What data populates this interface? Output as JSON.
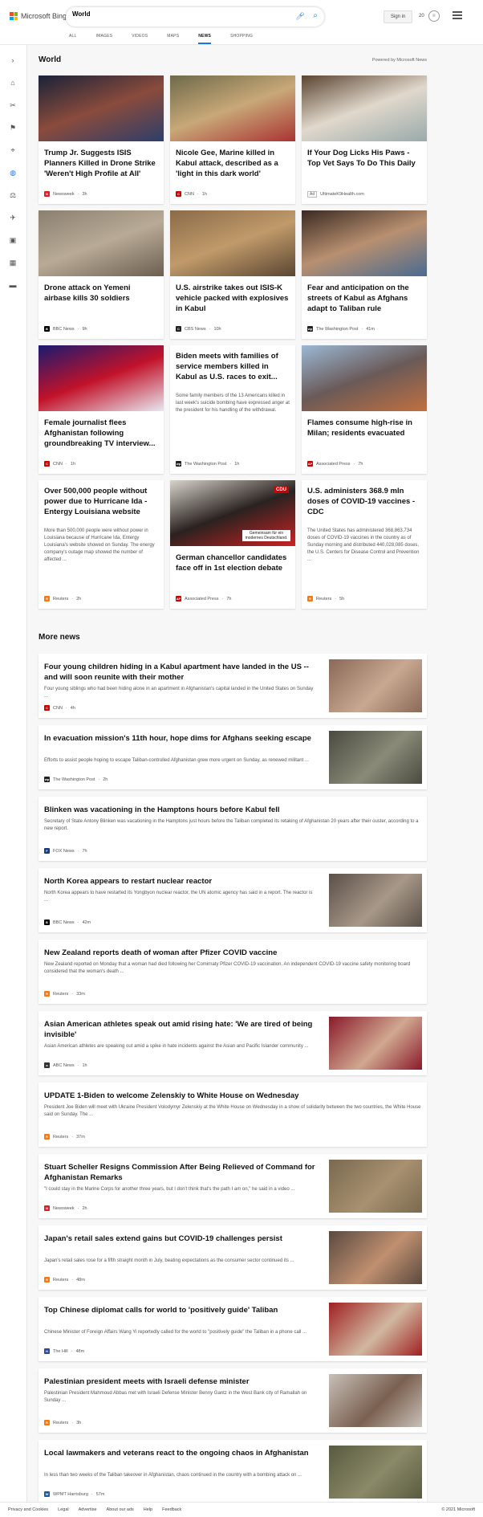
{
  "header": {
    "brand": "Microsoft Bing",
    "search_value": "World",
    "sign_in": "Sign in",
    "rewards_count": "20",
    "nav_tabs": [
      "ALL",
      "IMAGES",
      "VIDEOS",
      "MAPS",
      "NEWS",
      "SHOPPING"
    ],
    "active_tab": "NEWS"
  },
  "main": {
    "section_title": "World",
    "powered_by": "Powered by Microsoft News",
    "more_news_title": "More news"
  },
  "cards": [
    {
      "title": "Trump Jr. Suggests ISIS Planners Killed in Drone Strike 'Weren't High Profile at All'",
      "snippet": "",
      "source": "Newsweek",
      "time": "3h",
      "src_color": "#d2232a",
      "src_letter": "N",
      "img_colors": [
        "#1a2238",
        "#8a4b3c",
        "#2d3e6a"
      ]
    },
    {
      "title": "Nicole Gee, Marine killed in Kabul attack, described as a 'light in this dark world'",
      "snippet": "",
      "source": "CNN",
      "time": "1h",
      "src_color": "#cc0000",
      "src_letter": "C",
      "img_colors": [
        "#6e6a4a",
        "#c8a878",
        "#a33"
      ]
    },
    {
      "title": "If Your Dog Licks His Paws - Top Vet Says To Do This Daily",
      "snippet": "",
      "source": "UltimateK9Health.com",
      "time": "",
      "ad": "Ad",
      "src_color": "#bbb",
      "src_letter": "",
      "img_colors": [
        "#5a4430",
        "#e0d8cc",
        "#9aa"
      ]
    },
    {
      "title": "Drone attack on Yemeni airbase kills 30 soldiers",
      "snippet": "",
      "source": "BBC News",
      "time": "9h",
      "src_color": "#000",
      "src_letter": "B",
      "img_colors": [
        "#8a8070",
        "#b8aa96",
        "#6d5f50"
      ]
    },
    {
      "title": "U.S. airstrike takes out ISIS-K vehicle packed with explosives in Kabul",
      "snippet": "",
      "source": "CBS News",
      "time": "10h",
      "src_color": "#222",
      "src_letter": "C",
      "img_colors": [
        "#8a6a48",
        "#c09a6a",
        "#5a4632"
      ]
    },
    {
      "title": "Fear and anticipation on the streets of Kabul as Afghans adapt to Taliban rule",
      "snippet": "",
      "source": "The Washington Post",
      "time": "41m",
      "src_color": "#222",
      "src_letter": "wp",
      "img_colors": [
        "#3a2a22",
        "#b89070",
        "#4a6a90"
      ]
    },
    {
      "title": "Female journalist flees Afghanistan following groundbreaking TV interview...",
      "snippet": "",
      "source": "CNN",
      "time": "1h",
      "src_color": "#cc0000",
      "src_letter": "C",
      "img_colors": [
        "#1a1a70",
        "#c2122a",
        "#e8e8f0"
      ]
    },
    {
      "title": "Biden meets with families of service members killed in Kabul as U.S. races to exit...",
      "snippet": "Some family members of the 13 Americans killed in last week's suicide bombing have expressed anger at the president for his handling of the withdrawal.",
      "source": "The Washington Post",
      "time": "1h",
      "src_color": "#222",
      "src_letter": "wp",
      "img_colors": []
    },
    {
      "title": "Flames consume high-rise in Milan; residents evacuated",
      "snippet": "",
      "source": "Associated Press",
      "time": "7h",
      "src_color": "#c00",
      "src_letter": "AP",
      "img_colors": [
        "#9bb8d4",
        "#6a5a58",
        "#c07040"
      ]
    },
    {
      "title": "Over 500,000 people without power due to Hurricane Ida - Entergy Louisiana website",
      "snippet": "More than 500,000 people were without power in Louisiana because of Hurricane Ida, Entergy Louisiana's website showed on Sunday. The energy company's outage map showed the number of affected ...",
      "source": "Reuters",
      "time": "2h",
      "src_color": "#f07a1a",
      "src_letter": "R",
      "img_colors": []
    },
    {
      "title": "German chancellor candidates face off in 1st election debate",
      "snippet": "",
      "source": "Associated Press",
      "time": "7h",
      "src_color": "#c00",
      "src_letter": "AP",
      "img_colors": [
        "#d8d4cc",
        "#2a2220",
        "#c22"
      ],
      "img_text": [
        "CDU",
        "Gemeinsam für ein modernes Deutschland."
      ]
    },
    {
      "title": "U.S. administers 368.9 mln doses of COVID-19 vaccines - CDC",
      "snippet": "The United States has administered 368,863,734 doses of COVID-19 vaccines in the country as of Sunday morning and distributed 440,028,085 doses, the U.S. Centers for Disease Control and Prevention ...",
      "source": "Reuters",
      "time": "5h",
      "src_color": "#f07a1a",
      "src_letter": "R",
      "img_colors": []
    }
  ],
  "more_news": [
    {
      "title": "Four young children hiding in a Kabul apartment have landed in the US -- and will soon reunite with their mother",
      "snippet": "Four young siblings who had been hiding alone in an apartment in Afghanistan's capital landed in the United States on Sunday ...",
      "source": "CNN",
      "time": "4h",
      "src_color": "#cc0000",
      "src_letter": "C",
      "img_colors": [
        "#8a6a58",
        "#c8a890"
      ]
    },
    {
      "title": "In evacuation mission's 11th hour, hope dims for Afghans seeking escape",
      "snippet": "Efforts to assist people hoping to escape Taliban-controlled Afghanistan grew more urgent on Sunday, as renewed militant ...",
      "source": "The Washington Post",
      "time": "2h",
      "src_color": "#222",
      "src_letter": "wp",
      "img_colors": [
        "#4a4a40",
        "#8a8a78"
      ]
    },
    {
      "title": "Blinken was vacationing in the Hamptons hours before Kabul fell",
      "snippet": "Secretary of State Antony Blinken was vacationing in the Hamptons just hours before the Taliban completed its retaking of Afghanistan 20 years after their ouster, according to a new report.",
      "source": "FOX News",
      "time": "7h",
      "src_color": "#1a3a7a",
      "src_letter": "F",
      "img_colors": []
    },
    {
      "title": "North Korea appears to restart nuclear reactor",
      "snippet": "North Korea appears to have restarted its Yongbyon nuclear reactor, the UN atomic agency has said in a report. The reactor is ...",
      "source": "BBC News",
      "time": "42m",
      "src_color": "#000",
      "src_letter": "B",
      "img_colors": [
        "#5a5048",
        "#a89888"
      ]
    },
    {
      "title": "New Zealand reports death of woman after Pfizer COVID vaccine",
      "snippet": "New Zealand reported on Monday that a woman had died following her Comirnaty Pfizer COVID-19 vaccination. An independent COVID-19 vaccine safety monitoring board considered that the woman's death ...",
      "source": "Reuters",
      "time": "33m",
      "src_color": "#f07a1a",
      "src_letter": "R",
      "img_colors": []
    },
    {
      "title": "Asian American athletes speak out amid rising hate: 'We are tired of being invisible'",
      "snippet": "Asian American athletes are speaking out amid a spike in hate incidents against the Asian and Pacific Islander community ...",
      "source": "ABC News",
      "time": "1h",
      "src_color": "#333",
      "src_letter": "a",
      "img_colors": [
        "#8a1a2a",
        "#d0a890"
      ]
    },
    {
      "title": "UPDATE 1-Biden to welcome Zelenskiy to White House on Wednesday",
      "snippet": "President Joe Biden will meet with Ukraine President Volodymyr Zelenskiy at the White House on Wednesday in a show of solidarity between the two countries, the White House said on Sunday. The ...",
      "source": "Reuters",
      "time": "37m",
      "src_color": "#f07a1a",
      "src_letter": "R",
      "img_colors": []
    },
    {
      "title": "Stuart Scheller Resigns Commission After Being Relieved of Command for Afghanistan Remarks",
      "snippet": "\"I could stay in the Marine Corps for another three years, but I don't think that's the path I am on,\" he said in a video ...",
      "source": "Newsweek",
      "time": "2h",
      "src_color": "#d2232a",
      "src_letter": "N",
      "img_colors": [
        "#7a6a50",
        "#a89070"
      ]
    },
    {
      "title": "Japan's retail sales extend gains but COVID-19 challenges persist",
      "snippet": "Japan's retail sales rose for a fifth straight month in July, beating expectations as the consumer sector continued its ...",
      "source": "Reuters",
      "time": "48m",
      "src_color": "#f07a1a",
      "src_letter": "R",
      "img_colors": [
        "#5a4a40",
        "#c09070"
      ]
    },
    {
      "title": "Top Chinese diplomat calls for world to 'positively guide' Taliban",
      "snippet": "Chinese Minister of Foreign Affairs Wang Yi reportedly called for the world to \"positively guide\" the Taliban in a phone call ...",
      "source": "The Hill",
      "time": "48m",
      "src_color": "#2a4aa0",
      "src_letter": "H",
      "img_colors": [
        "#a02020",
        "#d0b8a0"
      ]
    },
    {
      "title": "Palestinian president meets with Israeli defense minister",
      "snippet": "Palestinian President Mahmoud Abbas met with Israeli Defense Minister Benny Gantz in the West Bank city of Ramallah on Sunday ...",
      "source": "Reuters",
      "time": "3h",
      "src_color": "#f07a1a",
      "src_letter": "R",
      "img_colors": [
        "#c8c0b8",
        "#7a6050"
      ]
    },
    {
      "title": "Local lawmakers and veterans react to the ongoing chaos in Afghanistan",
      "snippet": "In less than two weeks of the Taliban takeover in Afghanistan, chaos continued in the country with a bombing attack on ...",
      "source": "WPMT Harrisburg",
      "time": "57m",
      "src_color": "#1a5aa0",
      "src_letter": "W",
      "img_colors": [
        "#5a5a40",
        "#8a8a68"
      ]
    }
  ],
  "footer": {
    "links": [
      "Privacy and Cookies",
      "Legal",
      "Advertise",
      "About our ads",
      "Help",
      "Feedback"
    ],
    "copyright": "© 2021 Microsoft"
  }
}
